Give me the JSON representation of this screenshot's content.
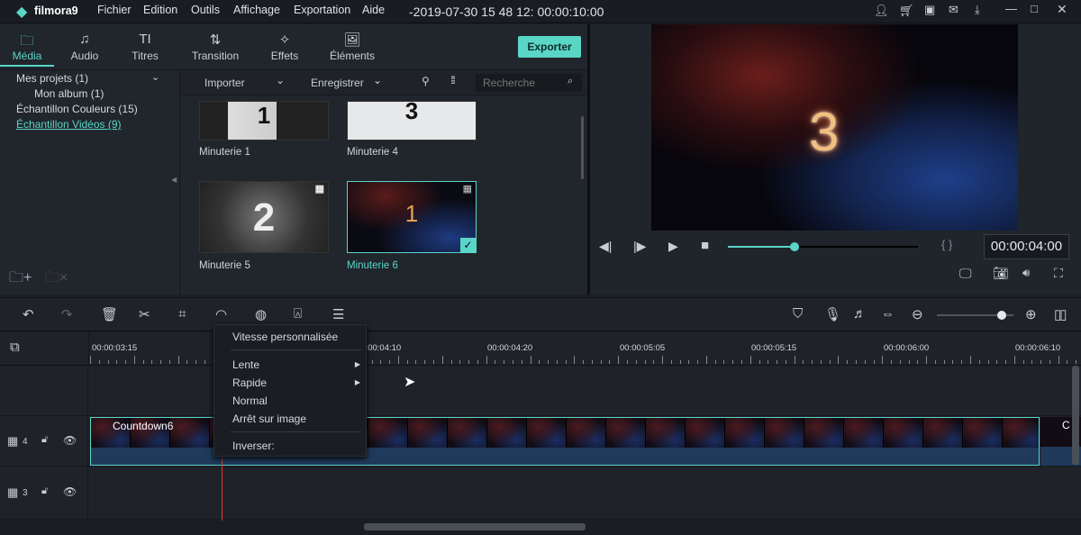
{
  "app": {
    "logo": "filmora9",
    "title": "-2019-07-30 15 48 12: 00:00:10:00",
    "menu": [
      "Fichier",
      "Edition",
      "Outils",
      "Affichage",
      "Exportation",
      "Aide"
    ]
  },
  "window_icons": [
    "user-icon",
    "cart-icon",
    "save-icon",
    "mail-icon",
    "download-icon",
    "minimize-icon",
    "maximize-icon",
    "close-icon"
  ],
  "tabs": [
    {
      "label": "Média",
      "icon": "folder-icon",
      "active": true
    },
    {
      "label": "Audio",
      "icon": "music-icon"
    },
    {
      "label": "Titres",
      "icon": "text-icon"
    },
    {
      "label": "Transition",
      "icon": "transition-icon"
    },
    {
      "label": "Effets",
      "icon": "effects-icon"
    },
    {
      "label": "Éléments",
      "icon": "image-icon"
    }
  ],
  "export_label": "Exporter",
  "tree": [
    {
      "label": "Mes projets (1)"
    },
    {
      "label": "Mon album (1)"
    },
    {
      "label": "Échantillon Couleurs (15)"
    },
    {
      "label": "Échantillon Vidéos (9)",
      "active": true
    }
  ],
  "media_toolbar": {
    "import": "Importer",
    "save": "Enregistrer",
    "search_placeholder": "Recherche"
  },
  "media_items": [
    {
      "name": "Minuterie 1",
      "digit": "1"
    },
    {
      "name": "Minuterie 4",
      "digit": "3"
    },
    {
      "name": "Minuterie 5",
      "digit": "2"
    },
    {
      "name": "Minuterie 6",
      "digit": "1",
      "selected": true
    }
  ],
  "preview": {
    "digit": "3",
    "timecode": "00:00:04:00",
    "progress": 0.35,
    "brackets": "{  }"
  },
  "ruler": [
    "00:00:03:15",
    "00:00:04:10",
    "00:00:04:20",
    "00:00:05:05",
    "00:00:05:15",
    "00:00:06:00",
    "00:00:06:10"
  ],
  "tracks": [
    {
      "number": "4",
      "clip": "Countdown6",
      "clip2": "C"
    },
    {
      "number": "3"
    }
  ],
  "zoom_level": 0.85,
  "context_menu": {
    "items": [
      "Vitesse personnalisée",
      "Lente",
      "Rapide",
      "Normal",
      "Arrêt sur image",
      "Inverser:"
    ]
  },
  "colors": {
    "accent": "#5ad6c7",
    "playhead": "#e03a3a"
  }
}
